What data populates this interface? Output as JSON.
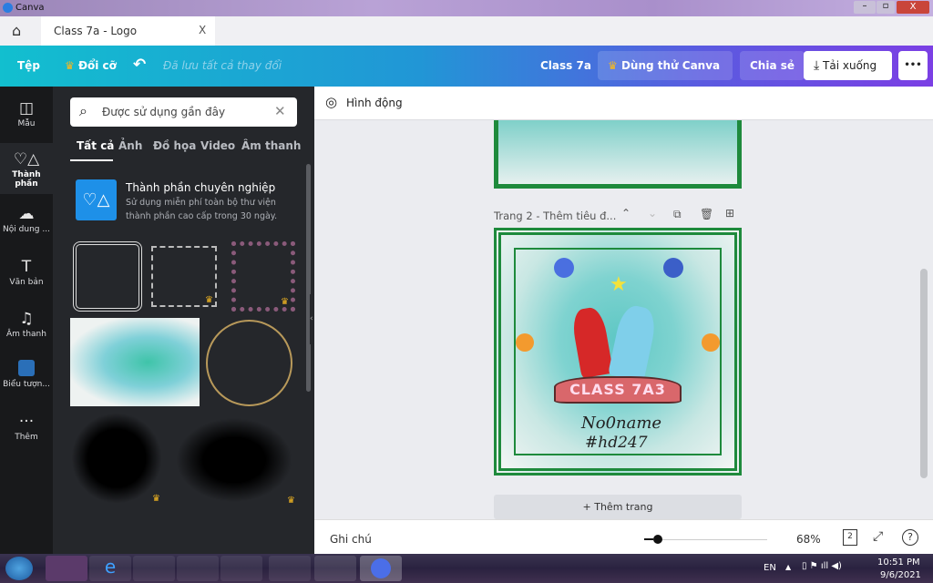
{
  "window": {
    "title": "Canva"
  },
  "tab": {
    "title": "Class 7a - Logo",
    "close": "X"
  },
  "toolbar": {
    "file": "Tệp",
    "resize": "Đổi cỡ",
    "saved": "Đã lưu tất cả thay đổi",
    "design_name": "Class 7a",
    "try_pro": "Dùng thử Canva Pro",
    "share": "Chia sẻ",
    "download": "Tải xuống",
    "more": "•••"
  },
  "rail": [
    {
      "label": "Mẫu"
    },
    {
      "label": "Thành phần"
    },
    {
      "label": "Nội dung ..."
    },
    {
      "label": "Văn bản"
    },
    {
      "label": "Âm thanh"
    },
    {
      "label": "Biểu tượn..."
    },
    {
      "label": "Thêm"
    }
  ],
  "panel": {
    "search_placeholder": "Được sử dụng gần đây",
    "tabs": [
      "Tất cả",
      "Ảnh",
      "Đồ họa",
      "Video",
      "Âm thanh"
    ],
    "promo_title": "Thành phần chuyên nghiệp",
    "promo_desc_1": "Sử dụng miễn phí toàn bộ thư viện",
    "promo_desc_2": "thành phần cao cấp trong 30 ngày."
  },
  "canvas": {
    "animate": "Hình động",
    "page2_label": "Trang 2 - Thêm tiêu đ...",
    "add_page": "+ Thêm trang",
    "design": {
      "banner": "CLASS 7A3",
      "sig1": "No0name",
      "sig2": "#hd247"
    }
  },
  "bottom": {
    "notes": "Ghi chú",
    "zoom": "68%",
    "zoom_value": 68,
    "pages": "2",
    "help": "?"
  },
  "taskbar": {
    "lang": "EN",
    "time": "10:51 PM",
    "date": "9/6/2021"
  },
  "colors": {
    "rail": "#18191b",
    "panel": "#25272b",
    "accent_start": "#12bfcf",
    "accent_end": "#7b3fe4"
  }
}
